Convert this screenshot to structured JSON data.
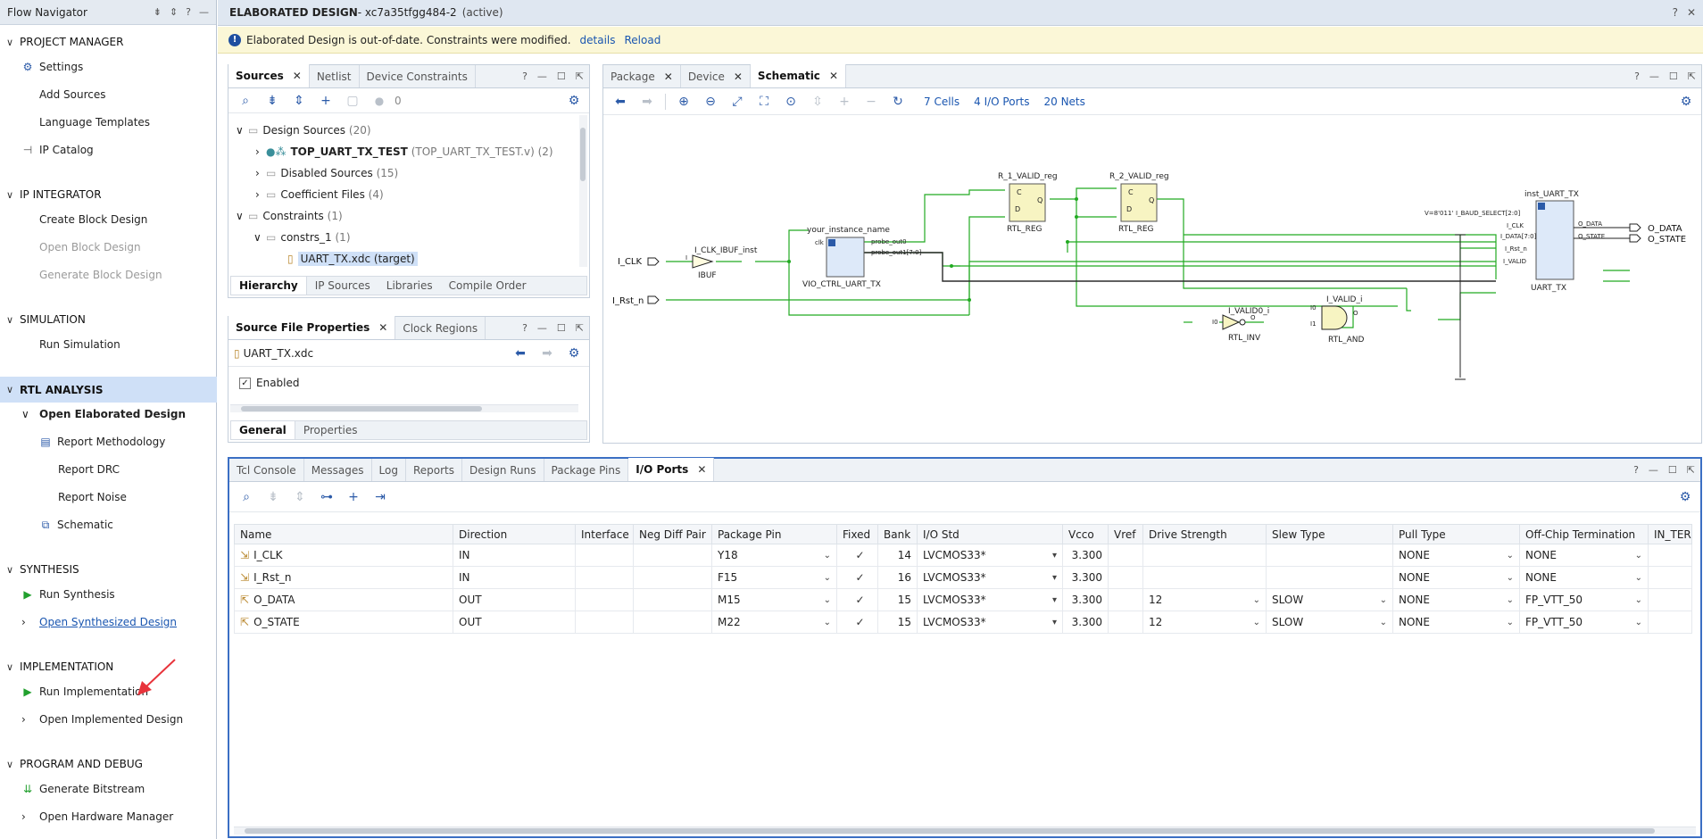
{
  "flow_navigator": {
    "title": "Flow Navigator",
    "sections": {
      "project_manager": {
        "label": "PROJECT MANAGER",
        "items": [
          "Settings",
          "Add Sources",
          "Language Templates",
          "IP Catalog"
        ]
      },
      "ip_integrator": {
        "label": "IP INTEGRATOR",
        "items": [
          "Create Block Design",
          "Open Block Design",
          "Generate Block Design"
        ]
      },
      "simulation": {
        "label": "SIMULATION",
        "items": [
          "Run Simulation"
        ]
      },
      "rtl_analysis": {
        "label": "RTL ANALYSIS",
        "open_elaborated": "Open Elaborated Design",
        "items": [
          "Report Methodology",
          "Report DRC",
          "Report Noise",
          "Schematic"
        ]
      },
      "synthesis": {
        "label": "SYNTHESIS",
        "items": [
          "Run Synthesis",
          "Open Synthesized Design"
        ]
      },
      "implementation": {
        "label": "IMPLEMENTATION",
        "items": [
          "Run Implementation",
          "Open Implemented Design"
        ]
      },
      "program_debug": {
        "label": "PROGRAM AND DEBUG",
        "items": [
          "Generate Bitstream",
          "Open Hardware Manager"
        ]
      }
    }
  },
  "header": {
    "title": "ELABORATED DESIGN",
    "part": " - xc7a35tfgg484-2",
    "status": "(active)"
  },
  "banner": {
    "message": "Elaborated Design is out-of-date. Constraints were modified.",
    "details_link": "details",
    "reload_link": "Reload"
  },
  "sources": {
    "tabs": [
      "Sources",
      "Netlist",
      "Device Constraints"
    ],
    "count": "0",
    "tree": {
      "design_sources": {
        "label": "Design Sources",
        "count": "(20)"
      },
      "top": {
        "label": "TOP_UART_TX_TEST",
        "file": "(TOP_UART_TX_TEST.v)",
        "count": "(2)"
      },
      "disabled": {
        "label": "Disabled Sources",
        "count": "(15)"
      },
      "coeff": {
        "label": "Coefficient Files",
        "count": "(4)"
      },
      "constraints": {
        "label": "Constraints",
        "count": "(1)"
      },
      "constrs": {
        "label": "constrs_1",
        "count": "(1)"
      },
      "xdc": {
        "label": "UART_TX.xdc (target)"
      }
    },
    "subtabs": [
      "Hierarchy",
      "IP Sources",
      "Libraries",
      "Compile Order"
    ]
  },
  "source_props": {
    "tabs": [
      "Source File Properties",
      "Clock Regions"
    ],
    "file": "UART_TX.xdc",
    "enabled_label": "Enabled",
    "subtabs": [
      "General",
      "Properties"
    ]
  },
  "schematic": {
    "tabs": [
      "Package",
      "Device",
      "Schematic"
    ],
    "stats": {
      "cells": "7 Cells",
      "ports": "4 I/O Ports",
      "nets": "20 Nets"
    },
    "labels": {
      "i_clk": "I_CLK",
      "i_rst": "I_Rst_n",
      "ibuf_inst": "I_CLK_IBUF_inst",
      "ibuf_type": "IBUF",
      "ibuf_pin": "I",
      "vio_name": "your_instance_name",
      "vio_type": "VIO_CTRL_UART_TX",
      "vio_clk": "clk",
      "probe0": "probe_out0",
      "probe1": "probe_out1[7:0]",
      "r1_name": "R_1_VALID_reg",
      "r2_name": "R_2_VALID_reg",
      "reg_type": "RTL_REG",
      "pin_c": "C",
      "pin_d": "D",
      "pin_q": "Q",
      "inv_name": "I_VALID0_i",
      "inv_type": "RTL_INV",
      "inv_i": "I0",
      "pin_o": "O",
      "and_name": "I_VALID_i",
      "and_type": "RTL_AND",
      "and_i0": "I0",
      "and_i1": "I1",
      "uart_name": "inst_UART_TX",
      "uart_type": "UART_TX",
      "const": "V=8'011'",
      "uart_baud": "I_BAUD_SELECT[2:0]",
      "uart_clk": "I_CLK",
      "uart_data": "I_DATA[7:0]",
      "uart_rst": "I_Rst_n",
      "uart_valid": "I_VALID",
      "uart_odata": "O_DATA",
      "uart_ostate": "O_STATE",
      "o_data": "O_DATA",
      "o_state": "O_STATE"
    }
  },
  "bottom": {
    "tabs": [
      "Tcl Console",
      "Messages",
      "Log",
      "Reports",
      "Design Runs",
      "Package Pins",
      "I/O Ports"
    ],
    "columns": [
      "Name",
      "Direction",
      "Interface",
      "Neg Diff Pair",
      "Package Pin",
      "Fixed",
      "Bank",
      "I/O Std",
      "Vcco",
      "Vref",
      "Drive Strength",
      "Slew Type",
      "Pull Type",
      "Off-Chip Termination",
      "IN_TER"
    ],
    "rows": [
      {
        "name": "I_CLK",
        "dir": "IN",
        "iface": "",
        "neg": "",
        "pin": "Y18",
        "fixed": "✓",
        "bank": "14",
        "std": "LVCMOS33*",
        "vcco": "3.300",
        "vref": "",
        "drive": "",
        "slew": "",
        "pull": "NONE",
        "term": "NONE"
      },
      {
        "name": "I_Rst_n",
        "dir": "IN",
        "iface": "",
        "neg": "",
        "pin": "F15",
        "fixed": "✓",
        "bank": "16",
        "std": "LVCMOS33*",
        "vcco": "3.300",
        "vref": "",
        "drive": "",
        "slew": "",
        "pull": "NONE",
        "term": "NONE"
      },
      {
        "name": "O_DATA",
        "dir": "OUT",
        "iface": "",
        "neg": "",
        "pin": "M15",
        "fixed": "✓",
        "bank": "15",
        "std": "LVCMOS33*",
        "vcco": "3.300",
        "vref": "",
        "drive": "12",
        "slew": "SLOW",
        "pull": "NONE",
        "term": "FP_VTT_50"
      },
      {
        "name": "O_STATE",
        "dir": "OUT",
        "iface": "",
        "neg": "",
        "pin": "M22",
        "fixed": "✓",
        "bank": "15",
        "std": "LVCMOS33*",
        "vcco": "3.300",
        "vref": "",
        "drive": "12",
        "slew": "SLOW",
        "pull": "NONE",
        "term": "FP_VTT_50"
      }
    ]
  },
  "colors": {
    "accent": "#2b5aa8",
    "selection": "#cfe0f7",
    "wire": "#22aa22",
    "cell": "#f7f4c2",
    "annotation": "#e8333b"
  }
}
